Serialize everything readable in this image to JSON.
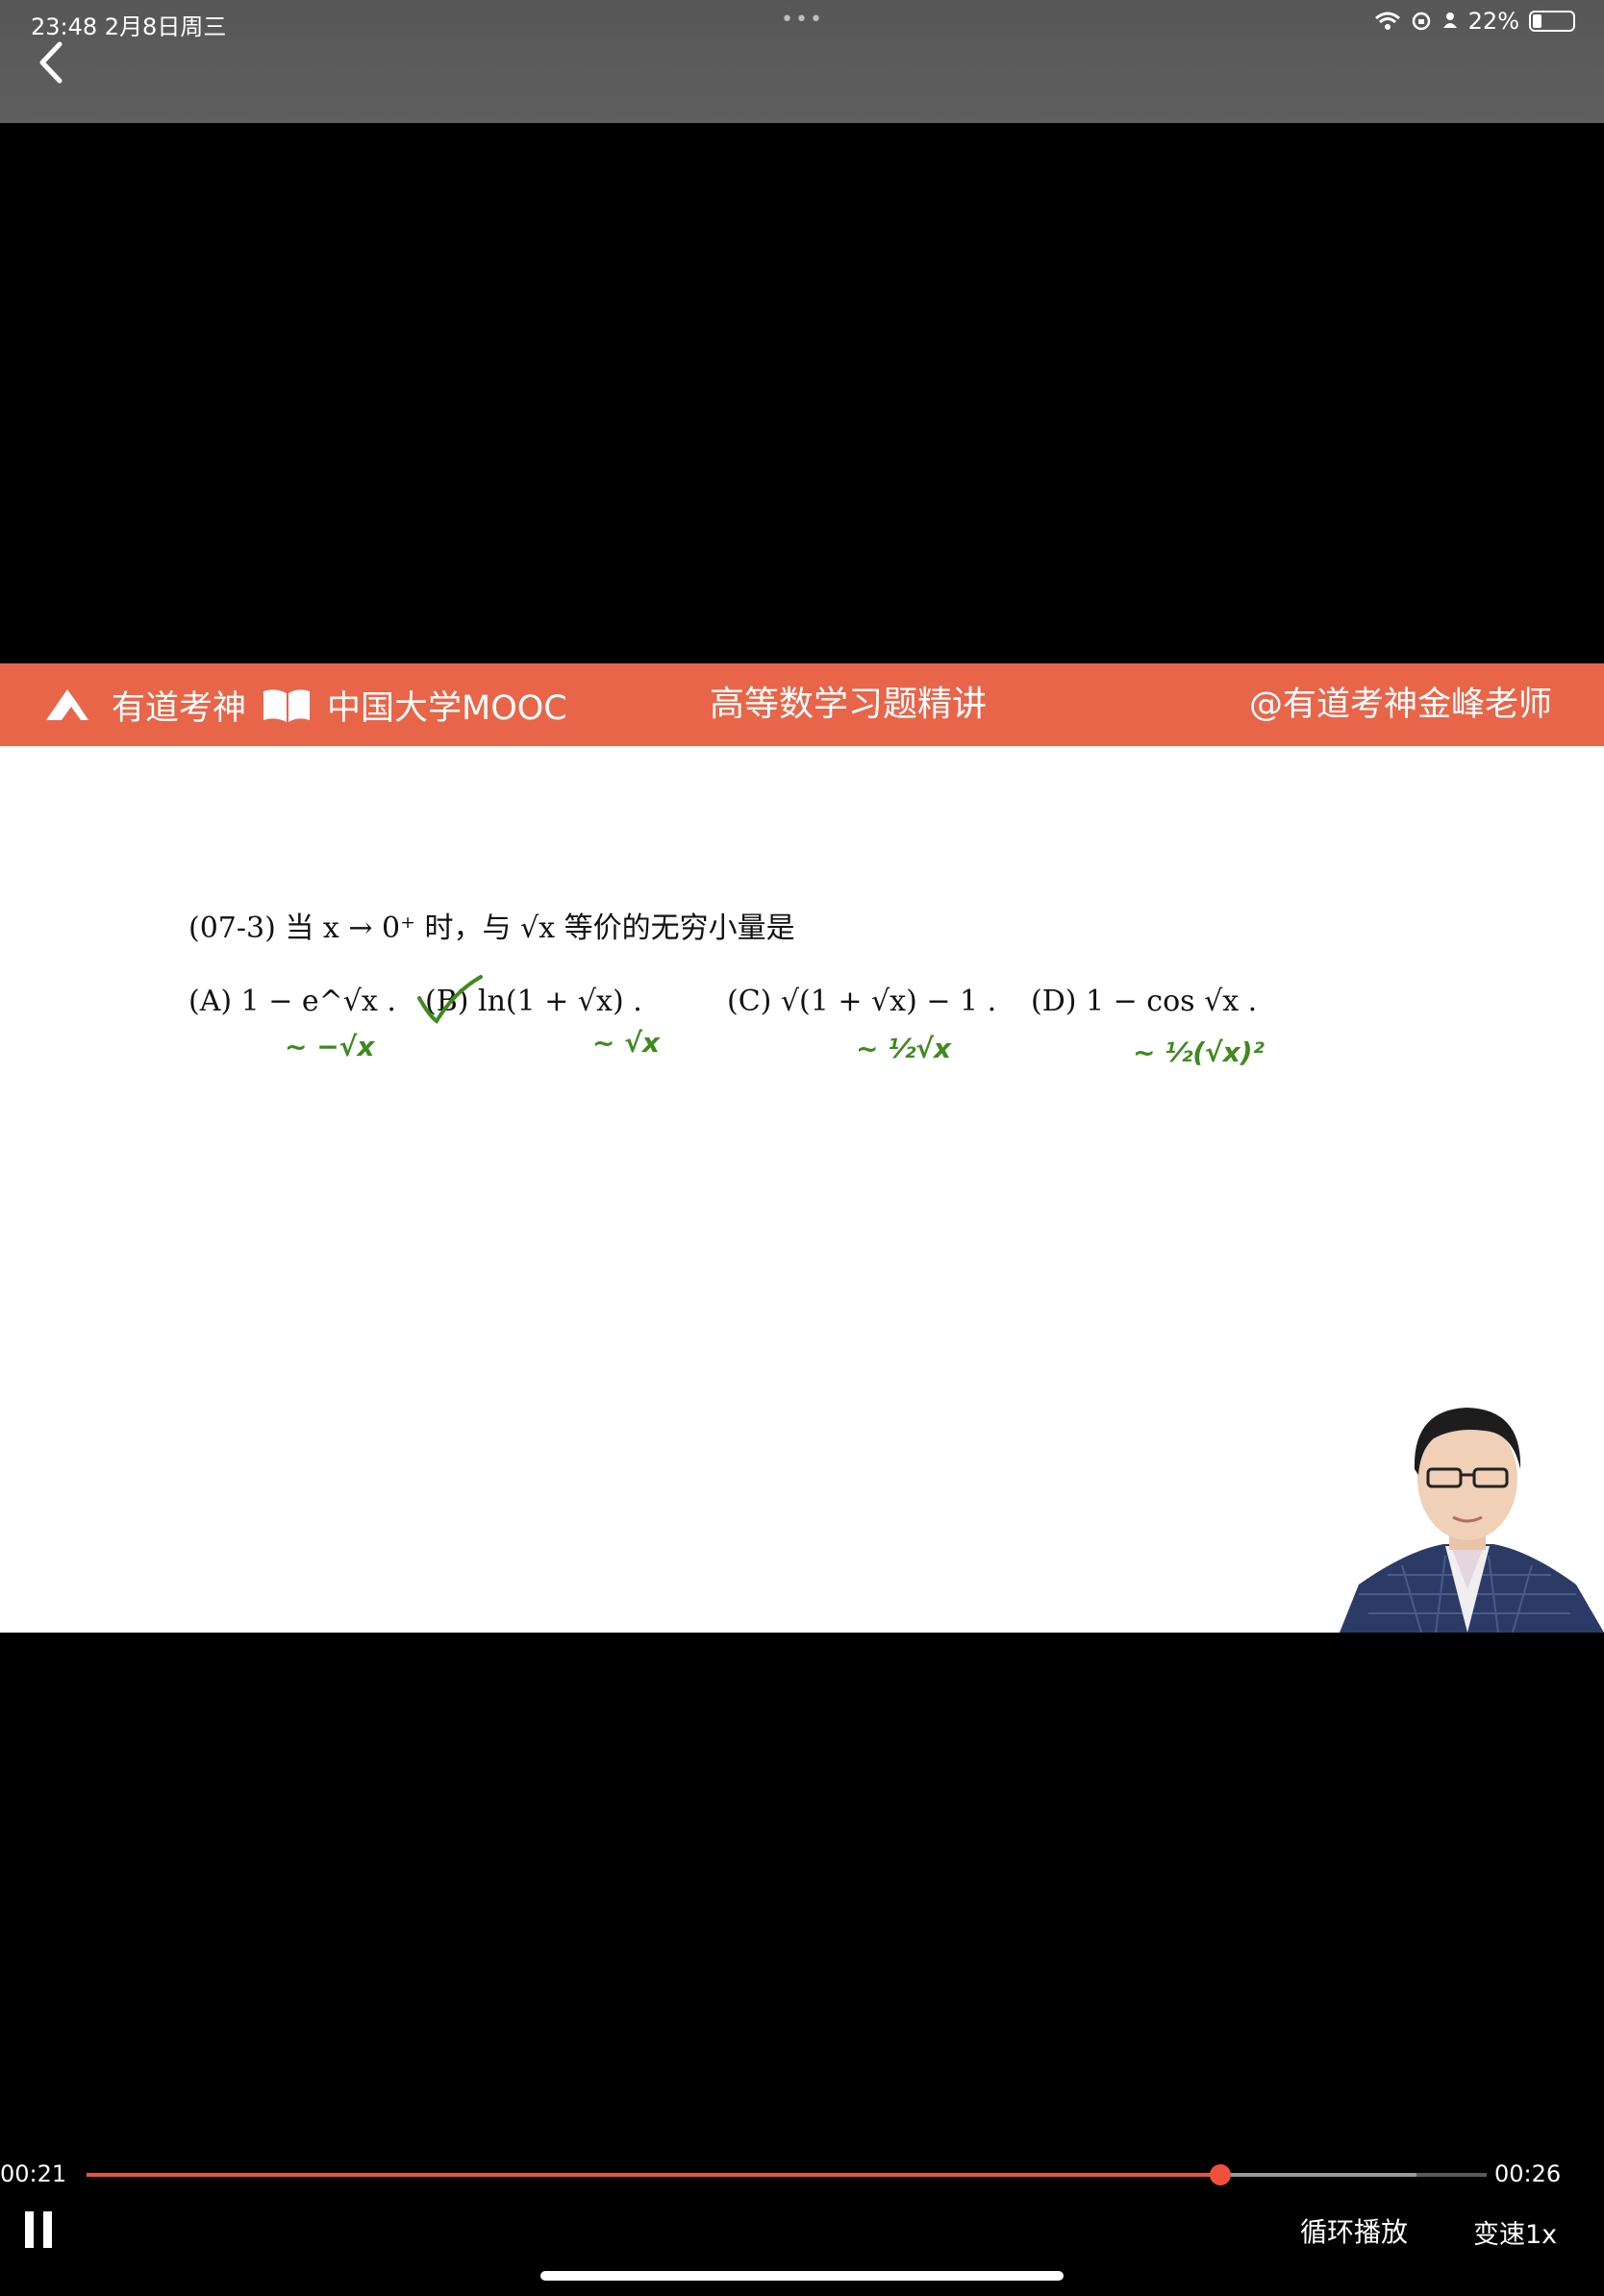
{
  "status_bar": {
    "time_date": "23:48   2月8日周三",
    "dots": "•••",
    "battery": "22%",
    "icons": [
      "wifi-icon",
      "lock-rotation-icon",
      "person-icon",
      "battery-icon"
    ]
  },
  "banner": {
    "brand1": "有道考神",
    "brand2": "中国大学MOOC",
    "course_title": "高等数学习题精讲",
    "teacher_handle": "@有道考神金峰老师",
    "color": "#e8654a"
  },
  "slide": {
    "question": "(07-3) 当 x → 0⁺ 时，与 √x 等价的无穷小量是",
    "options": [
      {
        "label": "(A)",
        "expr": "1 − e^√x ."
      },
      {
        "label": "(B)",
        "expr": "ln(1 + √x) ."
      },
      {
        "label": "(C)",
        "expr": "√(1 + √x) − 1 ."
      },
      {
        "label": "(D)",
        "expr": "1 − cos √x ."
      }
    ],
    "handwriting": [
      {
        "text": "~ −√x"
      },
      {
        "text": "~ √x"
      },
      {
        "text": "~ ½√x"
      },
      {
        "text": "~ ½(√x)²"
      }
    ],
    "correct_mark": "B",
    "handwriting_color": "#3f8a1e"
  },
  "player": {
    "current_time": "00:21",
    "total_time": "00:26",
    "progress": 0.81,
    "buffered": 0.95,
    "loop_label": "循环播放",
    "speed_label": "变速1x",
    "progress_color": "#e8543f"
  }
}
